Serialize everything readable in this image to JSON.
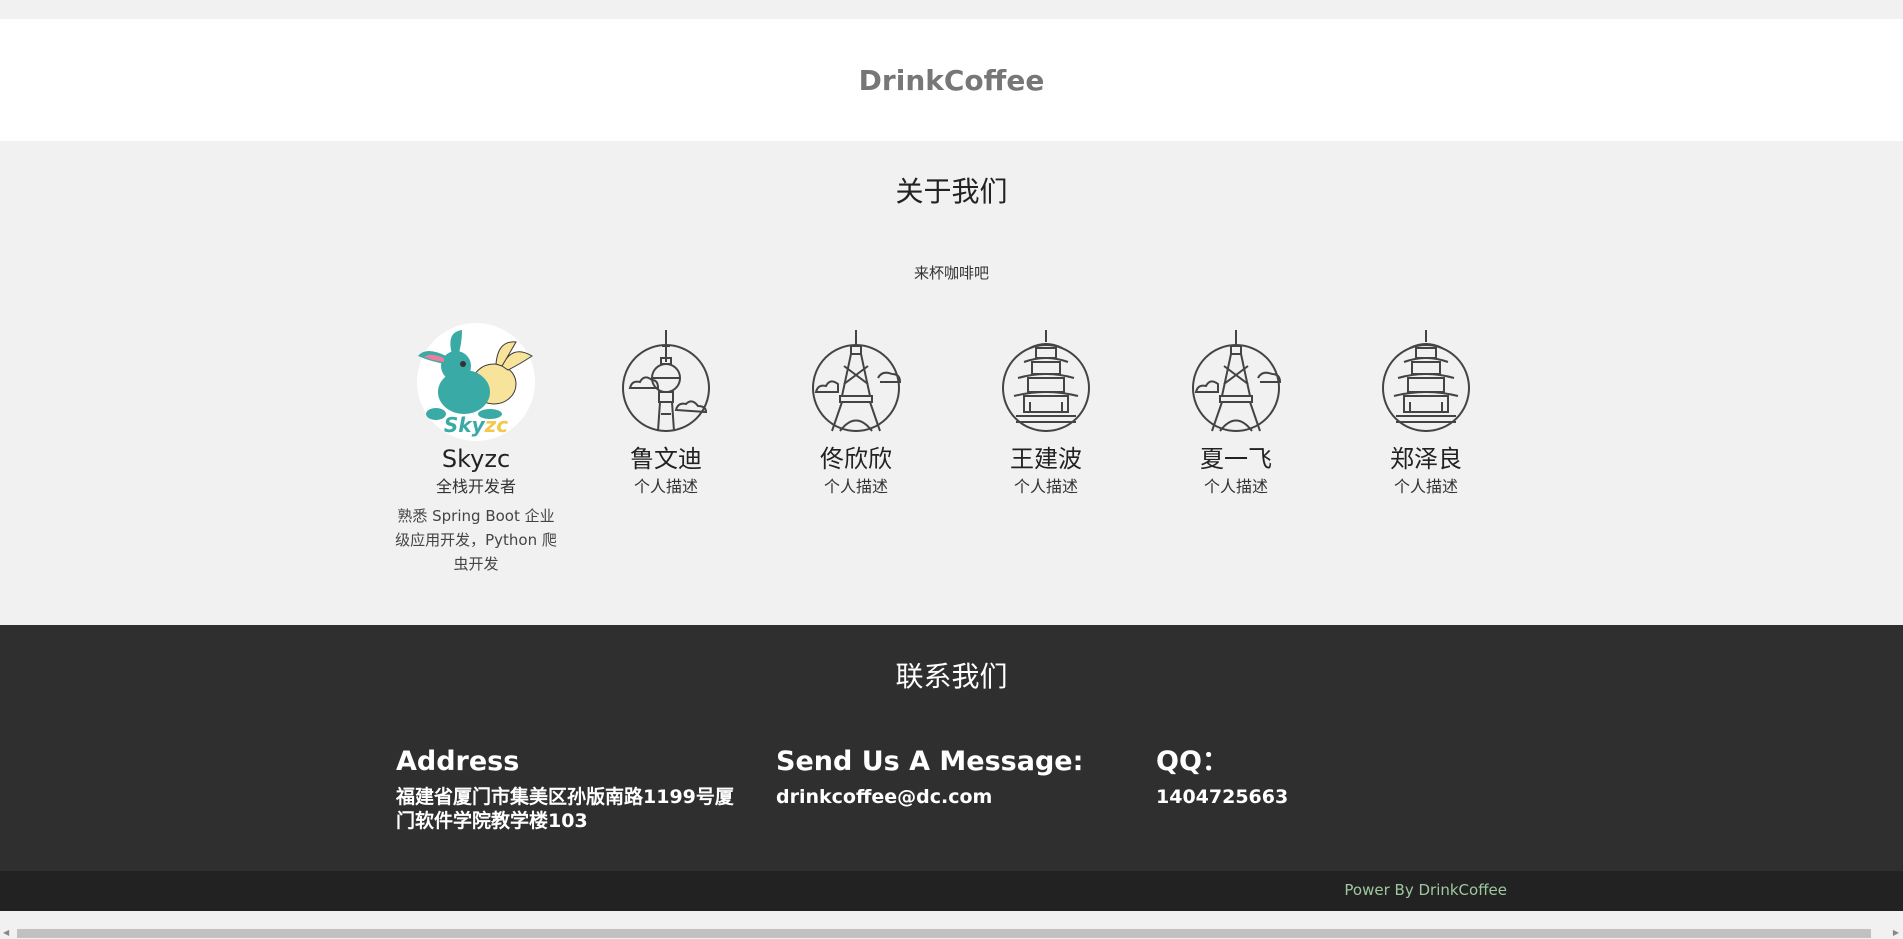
{
  "header": {
    "brand": "DrinkCoffee"
  },
  "about": {
    "title": "关于我们",
    "subtitle": "来杯咖啡吧",
    "members": [
      {
        "name": "Skyzc",
        "role": "全栈开发者",
        "desc": "熟悉 Spring Boot 企业级应用开发，Python 爬虫开发",
        "icon": "rabbit-avatar"
      },
      {
        "name": "鲁文迪",
        "role": "个人描述",
        "icon": "tv-tower-icon"
      },
      {
        "name": "佟欣欣",
        "role": "个人描述",
        "icon": "eiffel-tower-icon"
      },
      {
        "name": "王建波",
        "role": "个人描述",
        "icon": "pagoda-icon"
      },
      {
        "name": "夏一飞",
        "role": "个人描述",
        "icon": "eiffel-tower-icon"
      },
      {
        "name": "郑泽良",
        "role": "个人描述",
        "icon": "pagoda-icon"
      }
    ]
  },
  "contact": {
    "title": "联系我们",
    "address_heading": "Address",
    "address_text": "福建省厦门市集美区孙版南路1199号厦门软件学院教学楼103",
    "message_heading": "Send Us A Message:",
    "message_text": "drinkcoffee@dc.com",
    "qq_heading": "QQ：",
    "qq_text": "1404725663"
  },
  "footer": {
    "power": "Power By DrinkCoffee"
  },
  "colors": {
    "header_bg": "#ffffff",
    "page_bg": "#f1f1f1",
    "contact_bg": "#2f2f2f",
    "footer_bg": "#222222",
    "power_text": "#9fc79f",
    "avatar_teal": "#3aaaa6",
    "avatar_yellow": "#f8e39a"
  }
}
